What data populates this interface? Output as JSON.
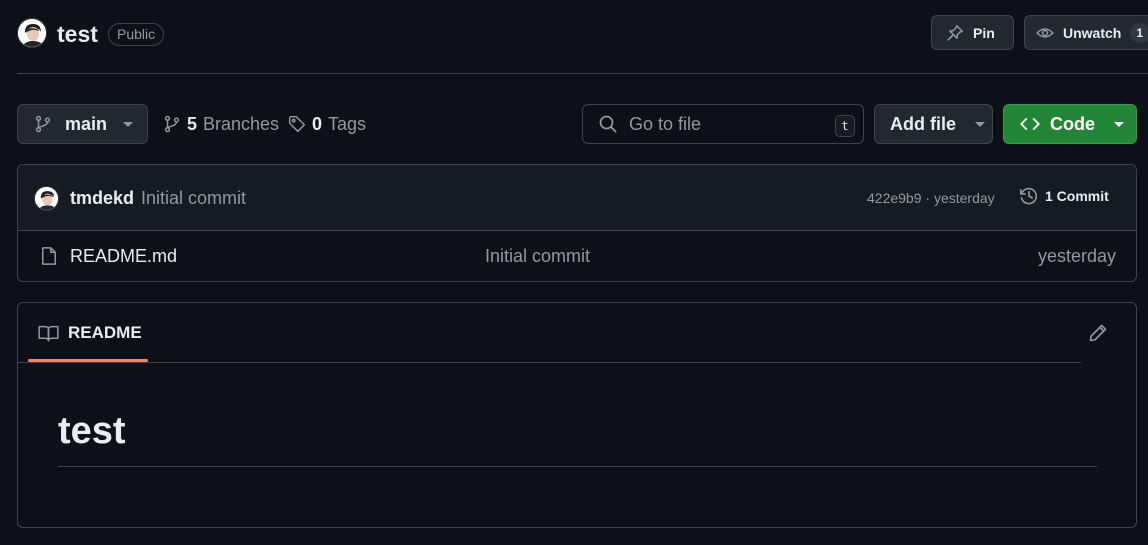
{
  "repo": {
    "name": "test",
    "visibility": "Public"
  },
  "header_actions": {
    "pin_label": "Pin",
    "watch_label": "Unwatch",
    "watch_count": "1"
  },
  "toolbar": {
    "branch": "main",
    "branches_count": "5",
    "branches_label": "Branches",
    "tags_count": "0",
    "tags_label": "Tags",
    "search_placeholder": "Go to file",
    "search_shortcut": "t",
    "add_file_label": "Add file",
    "code_label": "Code"
  },
  "latest_commit": {
    "author": "tmdekd",
    "message": "Initial commit",
    "meta": "422e9b9 · yesterday",
    "commit_count_label": "1 Commit"
  },
  "files": [
    {
      "name": "README.md",
      "commit_message": "Initial commit",
      "time": "yesterday"
    }
  ],
  "readme": {
    "tab_label": "README",
    "heading": "test"
  },
  "colors": {
    "background": "#0d1117",
    "border": "#3d444d",
    "code_button": "#238636",
    "tab_underline": "#f78166",
    "muted_text": "#9198a1"
  }
}
